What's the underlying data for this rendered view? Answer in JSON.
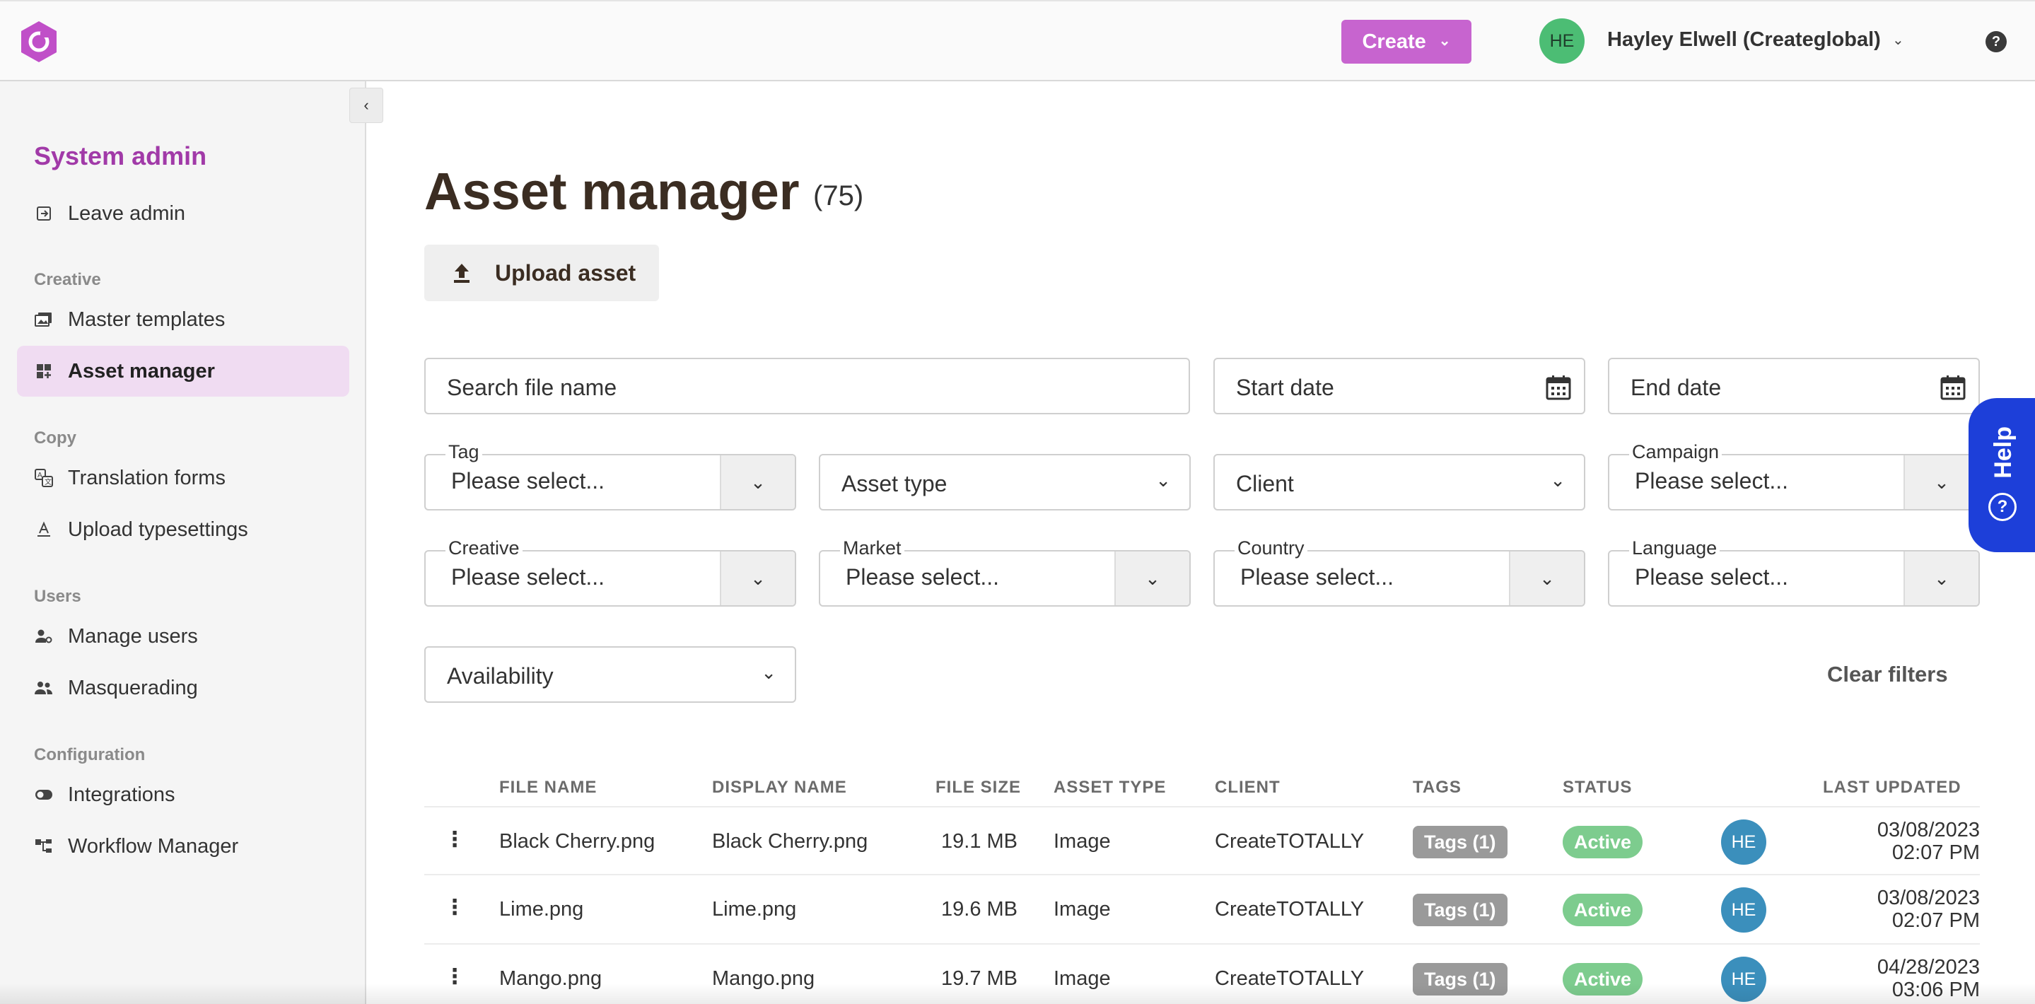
{
  "header": {
    "create_label": "Create",
    "user_initials": "HE",
    "user_name": "Hayley Elwell (Createglobal)",
    "colors": {
      "create": "#c764cf",
      "avatar": "#4cbd74"
    }
  },
  "sidebar": {
    "heading": "System admin",
    "leave_admin": "Leave admin",
    "sections": {
      "creative": "Creative",
      "copy": "Copy",
      "users": "Users",
      "configuration": "Configuration"
    },
    "items": {
      "master_templates": "Master templates",
      "asset_manager": "Asset manager",
      "translation_forms": "Translation forms",
      "upload_typesettings": "Upload typesettings",
      "manage_users": "Manage users",
      "masquerading": "Masquerading",
      "integrations": "Integrations",
      "workflow_manager": "Workflow Manager"
    }
  },
  "main": {
    "title": "Asset manager",
    "count": "(75)",
    "upload_label": "Upload asset",
    "filters": {
      "search_placeholder": "Search file name",
      "start_date": "Start date",
      "end_date": "End date",
      "tag_label": "Tag",
      "asset_type": "Asset type",
      "client": "Client",
      "campaign_label": "Campaign",
      "creative_label": "Creative",
      "market_label": "Market",
      "country_label": "Country",
      "language_label": "Language",
      "please_select": "Please select...",
      "availability": "Availability",
      "clear_filters": "Clear filters"
    },
    "help_tab": "Help"
  },
  "table": {
    "columns": {
      "file_name": "FILE NAME",
      "display_name": "DISPLAY NAME",
      "file_size": "FILE SIZE",
      "asset_type": "ASSET TYPE",
      "client": "CLIENT",
      "tags": "TAGS",
      "status": "STATUS",
      "last_updated": "LAST UPDATED"
    },
    "rows": [
      {
        "file_name": "Black Cherry.png",
        "display_name": "Black Cherry.png",
        "file_size": "19.1 MB",
        "asset_type": "Image",
        "client": "CreateTOTALLY",
        "tags": "Tags (1)",
        "status": "Active",
        "initials": "HE",
        "date": "03/08/2023",
        "time": "02:07 PM"
      },
      {
        "file_name": "Lime.png",
        "display_name": "Lime.png",
        "file_size": "19.6 MB",
        "asset_type": "Image",
        "client": "CreateTOTALLY",
        "tags": "Tags (1)",
        "status": "Active",
        "initials": "HE",
        "date": "03/08/2023",
        "time": "02:07 PM"
      },
      {
        "file_name": "Mango.png",
        "display_name": "Mango.png",
        "file_size": "19.7 MB",
        "asset_type": "Image",
        "client": "CreateTOTALLY",
        "tags": "Tags (1)",
        "status": "Active",
        "initials": "HE",
        "date": "04/28/2023",
        "time": "03:06 PM"
      }
    ]
  }
}
